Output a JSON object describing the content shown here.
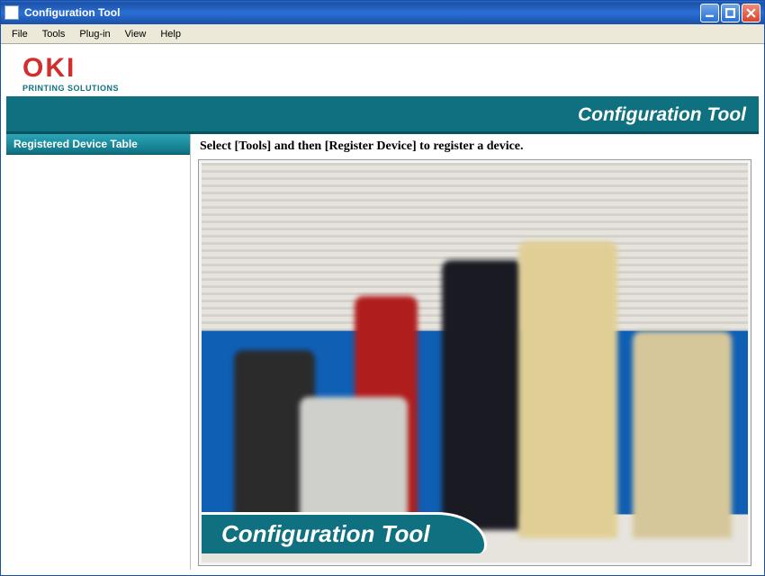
{
  "window": {
    "title": "Configuration Tool"
  },
  "menubar": {
    "items": [
      "File",
      "Tools",
      "Plug-in",
      "View",
      "Help"
    ]
  },
  "branding": {
    "logo_text": "OKI",
    "tagline": "PRINTING SOLUTIONS"
  },
  "banner": {
    "title": "Configuration Tool"
  },
  "sidebar": {
    "header": "Registered Device Table"
  },
  "main": {
    "instruction": "Select [Tools] and then [Register Device] to register a device.",
    "overlay_label": "Configuration Tool"
  },
  "colors": {
    "teal": "#0f7080",
    "oki_red": "#d42e2c"
  }
}
